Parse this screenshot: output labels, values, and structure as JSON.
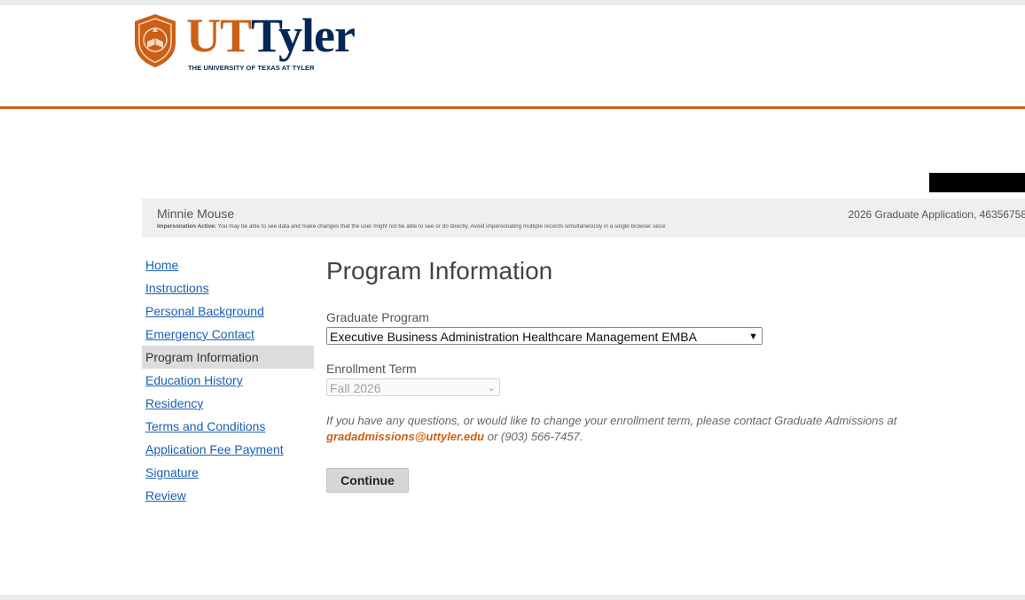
{
  "branding": {
    "logo_ut": "UT",
    "logo_tyler": "Tyler",
    "tagline": "THE UNIVERSITY OF TEXAS AT TYLER",
    "seal_icon": "ut-tyler-seal-icon"
  },
  "user_bar": {
    "name": "Minnie Mouse",
    "application_info": "2026 Graduate Application, 46356758",
    "impersonation_label": "Impersonation Active:",
    "impersonation_text": "You may be able to see data and make changes that the user might not be able to see or do directly. Avoid impersonating multiple records simultaneously in a single browser sessi"
  },
  "sidebar": {
    "items": [
      {
        "label": "Home",
        "active": false
      },
      {
        "label": "Instructions",
        "active": false
      },
      {
        "label": "Personal Background",
        "active": false
      },
      {
        "label": "Emergency Contact",
        "active": false
      },
      {
        "label": "Program Information",
        "active": true
      },
      {
        "label": "Education History",
        "active": false
      },
      {
        "label": "Residency",
        "active": false
      },
      {
        "label": "Terms and Conditions",
        "active": false
      },
      {
        "label": "Application Fee Payment",
        "active": false
      },
      {
        "label": "Signature",
        "active": false
      },
      {
        "label": "Review",
        "active": false
      }
    ]
  },
  "main": {
    "title": "Program Information",
    "graduate_program": {
      "label": "Graduate Program",
      "selected": "Executive Business Administration Healthcare Management EMBA"
    },
    "enrollment_term": {
      "label": "Enrollment Term",
      "selected": "Fall 2026"
    },
    "note": {
      "line1": "If you have any questions, or would like to change your enrollment term, please contact Graduate Admissions at",
      "email": "gradadmissions@uttyler.edu",
      "line2_suffix": " or (903) 566-7457."
    },
    "continue_label": "Continue"
  },
  "colors": {
    "brand_orange": "#cb6015",
    "brand_navy": "#002855",
    "link_blue": "#1a5fb4"
  }
}
